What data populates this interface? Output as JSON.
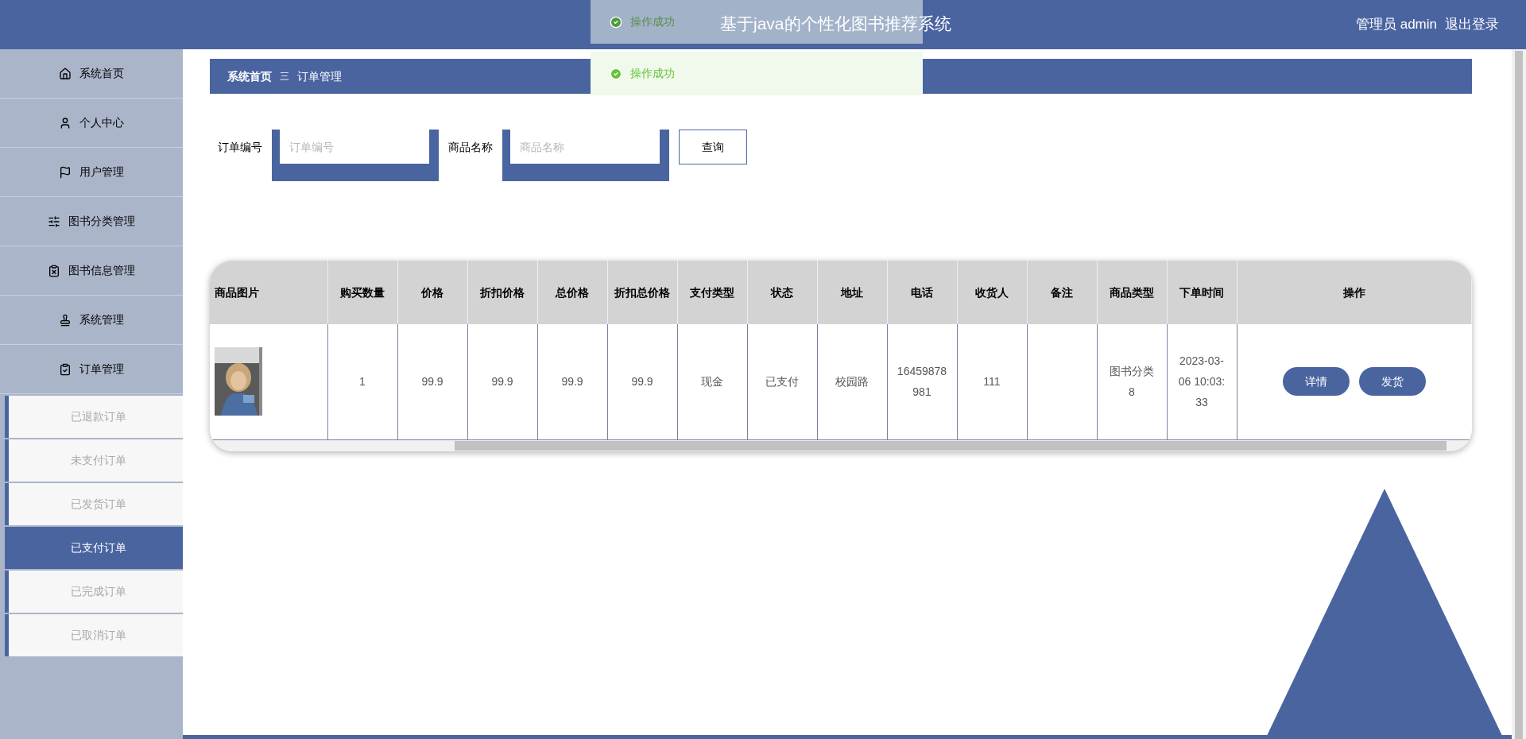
{
  "header": {
    "title": "基于java的个性化图书推荐系统",
    "user": "管理员 admin",
    "logout": "退出登录"
  },
  "toasts": [
    {
      "text": "操作成功",
      "faded": true
    },
    {
      "text": "操作成功",
      "faded": false
    }
  ],
  "sidebar": {
    "items": [
      {
        "label": "系统首页"
      },
      {
        "label": "个人中心"
      },
      {
        "label": "用户管理"
      },
      {
        "label": "图书分类管理"
      },
      {
        "label": "图书信息管理"
      },
      {
        "label": "系统管理"
      },
      {
        "label": "订单管理",
        "expanded": true,
        "children": [
          {
            "label": "已退款订单",
            "selected": false
          },
          {
            "label": "未支付订单",
            "selected": false
          },
          {
            "label": "已发货订单",
            "selected": false
          },
          {
            "label": "已支付订单",
            "selected": true
          },
          {
            "label": "已完成订单",
            "selected": false
          },
          {
            "label": "已取消订单",
            "selected": false
          }
        ]
      }
    ]
  },
  "breadcrumb": {
    "home": "系统首页",
    "separator": "三",
    "current": "订单管理"
  },
  "search": {
    "fields": [
      {
        "label": "订单编号",
        "placeholder": "订单编号"
      },
      {
        "label": "商品名称",
        "placeholder": "商品名称"
      }
    ],
    "button": "查询"
  },
  "table": {
    "columns": [
      "商品图片",
      "购买数量",
      "价格",
      "折扣价格",
      "总价格",
      "折扣总价格",
      "支付类型",
      "状态",
      "地址",
      "电话",
      "收货人",
      "备注",
      "商品类型",
      "下单时间",
      "操作"
    ],
    "rows": [
      {
        "cells": [
          {
            "kind": "picture"
          },
          {
            "kind": "text",
            "text": "1"
          },
          {
            "kind": "text",
            "text": "99.9"
          },
          {
            "kind": "text",
            "text": "99.9"
          },
          {
            "kind": "text",
            "text": "99.9"
          },
          {
            "kind": "text",
            "text": "99.9"
          },
          {
            "kind": "text",
            "text": "现金"
          },
          {
            "kind": "text",
            "text": "已支付"
          },
          {
            "kind": "text",
            "text": "校园路"
          },
          {
            "kind": "text",
            "text": "16459878981"
          },
          {
            "kind": "text",
            "text": "111"
          },
          {
            "kind": "text",
            "text": ""
          },
          {
            "kind": "text",
            "text": "图书分类8"
          },
          {
            "kind": "text",
            "text": "2023-03-06 10:03:33"
          },
          {
            "kind": "buttons",
            "buttons": [
              "详情",
              "发货"
            ]
          }
        ]
      }
    ]
  }
}
